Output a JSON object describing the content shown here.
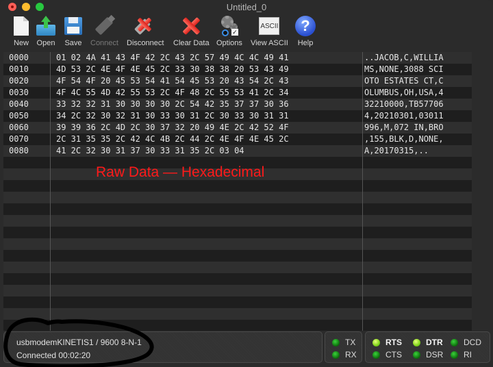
{
  "window": {
    "title": "Untitled_0"
  },
  "toolbar": {
    "items": [
      {
        "id": "new",
        "label": "New",
        "icon": "new-document-icon",
        "enabled": true
      },
      {
        "id": "open",
        "label": "Open",
        "icon": "open-folder-icon",
        "enabled": true
      },
      {
        "id": "save",
        "label": "Save",
        "icon": "floppy-disk-icon",
        "enabled": true
      },
      {
        "id": "connect",
        "label": "Connect",
        "icon": "usb-plug-icon",
        "enabled": false
      },
      {
        "id": "disconnect",
        "label": "Disconnect",
        "icon": "usb-plug-x-icon",
        "enabled": true
      },
      {
        "id": "clear",
        "label": "Clear Data",
        "icon": "red-x-icon",
        "enabled": true
      },
      {
        "id": "options",
        "label": "Options",
        "icon": "gears-icon",
        "enabled": true
      },
      {
        "id": "view_ascii",
        "label": "View ASCII",
        "icon": "ascii-icon",
        "icon_text": "ASCII",
        "enabled": true
      },
      {
        "id": "help",
        "label": "Help",
        "icon": "help-icon",
        "icon_text": "?",
        "enabled": true
      }
    ]
  },
  "data_view": {
    "rows": [
      {
        "address": "0000",
        "hex": "01 02 4A 41 43 4F 42 2C 43 2C 57 49 4C 4C 49 41",
        "ascii": "..JACOB,C,WILLIA"
      },
      {
        "address": "0010",
        "hex": "4D 53 2C 4E 4F 4E 45 2C 33 30 38 38 20 53 43 49",
        "ascii": "MS,NONE,3088 SCI"
      },
      {
        "address": "0020",
        "hex": "4F 54 4F 20 45 53 54 41 54 45 53 20 43 54 2C 43",
        "ascii": "OTO ESTATES CT,C"
      },
      {
        "address": "0030",
        "hex": "4F 4C 55 4D 42 55 53 2C 4F 48 2C 55 53 41 2C 34",
        "ascii": "OLUMBUS,OH,USA,4"
      },
      {
        "address": "0040",
        "hex": "33 32 32 31 30 30 30 30 2C 54 42 35 37 37 30 36",
        "ascii": "32210000,TB57706"
      },
      {
        "address": "0050",
        "hex": "34 2C 32 30 32 31 30 33 30 31 2C 30 33 30 31 31",
        "ascii": "4,20210301,03011"
      },
      {
        "address": "0060",
        "hex": "39 39 36 2C 4D 2C 30 37 32 20 49 4E 2C 42 52 4F",
        "ascii": "996,M,072 IN,BRO"
      },
      {
        "address": "0070",
        "hex": "2C 31 35 35 2C 42 4C 4B 2C 44 2C 4E 4F 4E 45 2C",
        "ascii": ",155,BLK,D,NONE,"
      },
      {
        "address": "0080",
        "hex": "41 2C 32 30 31 37 30 33 31 35 2C 03 04",
        "ascii": "A,20170315,.."
      }
    ],
    "overlay_label": "Raw Data — Hexadecimal",
    "overlay_color": "#ff1a1a"
  },
  "status": {
    "port_line": "usbmodemKINETIS1 / 9600 8-N-1",
    "connection_line": "Connected 00:02:20",
    "line_indicators": [
      {
        "label": "TX",
        "active": false
      },
      {
        "label": "RX",
        "active": false
      }
    ],
    "signal_indicators": [
      {
        "label": "RTS",
        "active": true
      },
      {
        "label": "DTR",
        "active": true
      },
      {
        "label": "DCD",
        "active": false
      },
      {
        "label": "CTS",
        "active": false
      },
      {
        "label": "DSR",
        "active": false
      },
      {
        "label": "RI",
        "active": false
      }
    ]
  }
}
